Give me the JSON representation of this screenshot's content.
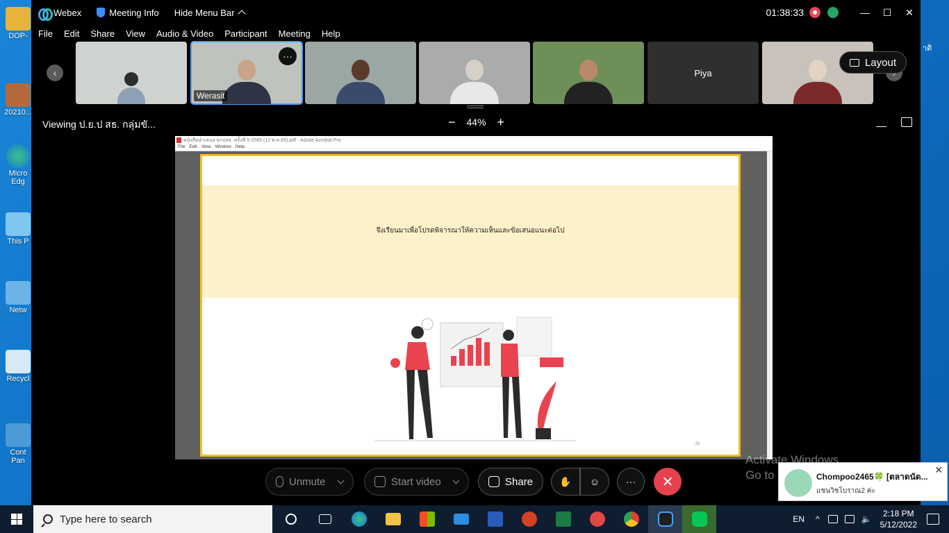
{
  "desktop": {
    "icons": [
      {
        "label": "DOP-"
      },
      {
        "label": "20210..."
      },
      {
        "label": "Micro Edg"
      },
      {
        "label": "This P"
      },
      {
        "label": "Netw"
      },
      {
        "label": "Recycl"
      },
      {
        "label": "Cont Pan"
      }
    ],
    "right_edge_text": "าติ"
  },
  "webex": {
    "app_name": "Webex",
    "meeting_info": "Meeting Info",
    "hide_menu_bar": "Hide Menu Bar",
    "timer": "01:38:33",
    "window_controls": {
      "minimize": "—",
      "maximize": "☐",
      "close": "✕"
    },
    "menu": [
      "File",
      "Edit",
      "Share",
      "View",
      "Audio & Video",
      "Participant",
      "Meeting",
      "Help"
    ],
    "participants": [
      {
        "name": "",
        "bg": "#cfd3cf"
      },
      {
        "name": "Werasit",
        "bg": "#bfc3bd",
        "more": "···",
        "active": true
      },
      {
        "name": "",
        "bg": "#9aa7a4"
      },
      {
        "name": "",
        "bg": "#a9acab"
      },
      {
        "name": "",
        "bg": "#6f8f59"
      },
      {
        "name": "Piya",
        "bg": "#2f2f2f"
      },
      {
        "name": "",
        "bg": "#c8c2bb"
      }
    ],
    "nav_prev": "‹",
    "nav_next": "›",
    "layout_button": "Layout",
    "viewing_text": "Viewing ป.ย.ป สธ. กลุ่มขั...",
    "zoom": {
      "minus": "−",
      "value": "44%",
      "plus": "+"
    },
    "shared": {
      "acrobat_title": "หนังสือนำเสนอ ยกปสธ. ครั้งที่ 5-2565 (12 พ.ค.65).pdf - Adobe Acrobat Pro",
      "acrobat_menu": [
        "File",
        "Edit",
        "View",
        "Window",
        "Help"
      ],
      "slide_text": "จึงเรียนมาเพื่อโปรดพิจารณาให้ความเห็นและข้อเสนอแนะต่อไป",
      "page_number": "33"
    },
    "controls": {
      "unmute": "Unmute",
      "start_video": "Start video",
      "share": "Share",
      "more": "···",
      "end": "✕"
    }
  },
  "watermark": {
    "line1": "Activate Windows",
    "line2": "Go to Se"
  },
  "notification": {
    "title": "Chompoo2465🍀 [ตลาดนัด...",
    "message": "แชนวิชโบราณ2 ค่ะ",
    "close": "✕"
  },
  "taskbar": {
    "search_placeholder": "Type here to search",
    "apps": [
      "cortana",
      "task-view",
      "edge",
      "file-explorer",
      "store",
      "mail",
      "word",
      "powerpoint",
      "excel",
      "app",
      "chrome",
      "webex",
      "line"
    ],
    "language": "EN",
    "time": "2:18 PM",
    "date": "5/12/2022"
  },
  "colors": {
    "accent": "#4f9cff",
    "end_call": "#e6424e",
    "slide_border": "#f5c018",
    "slide_band": "#fdf1cb",
    "chart_red": "#e8434f"
  }
}
